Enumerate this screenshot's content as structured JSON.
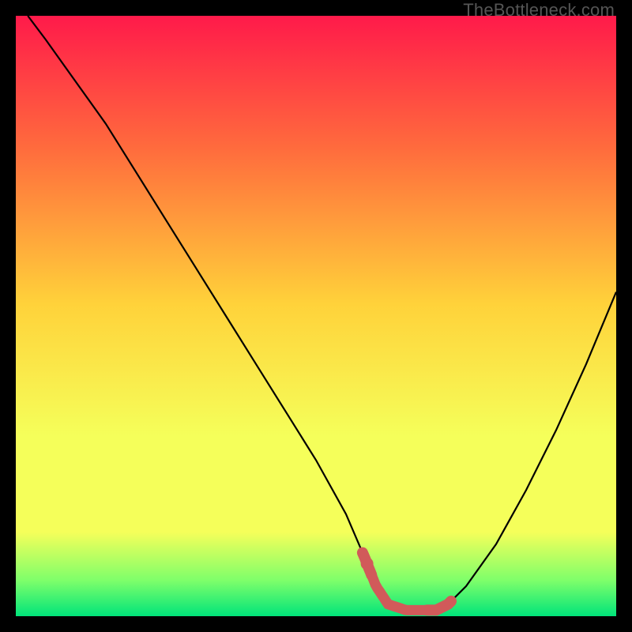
{
  "watermark": "TheBottleneck.com",
  "chart_data": {
    "type": "line",
    "title": "",
    "xlabel": "",
    "ylabel": "",
    "xlim": [
      0,
      100
    ],
    "ylim": [
      0,
      100
    ],
    "series": [
      {
        "name": "bottleneck-curve",
        "x": [
          2,
          5,
          10,
          15,
          20,
          25,
          30,
          35,
          40,
          45,
          50,
          55,
          58,
          60,
          62,
          65,
          68,
          70,
          72,
          75,
          80,
          85,
          90,
          95,
          100
        ],
        "y": [
          100,
          96,
          89,
          82,
          74,
          66,
          58,
          50,
          42,
          34,
          26,
          17,
          10,
          5,
          2,
          1,
          1,
          1,
          2,
          5,
          12,
          21,
          31,
          42,
          54
        ]
      }
    ],
    "markers": [
      {
        "name": "marker-a",
        "x": 58.5,
        "y": 3.5
      },
      {
        "name": "marker-b",
        "x": 70.5,
        "y": 4.0
      }
    ],
    "marker_color": "#d15a5a",
    "gradient": {
      "top": "#ff1a4a",
      "upper_mid": "#ff6b3d",
      "mid": "#ffd23a",
      "lower_mid": "#f5ff5a",
      "near_bottom": "#7fff6a",
      "bottom": "#00e47a"
    }
  }
}
